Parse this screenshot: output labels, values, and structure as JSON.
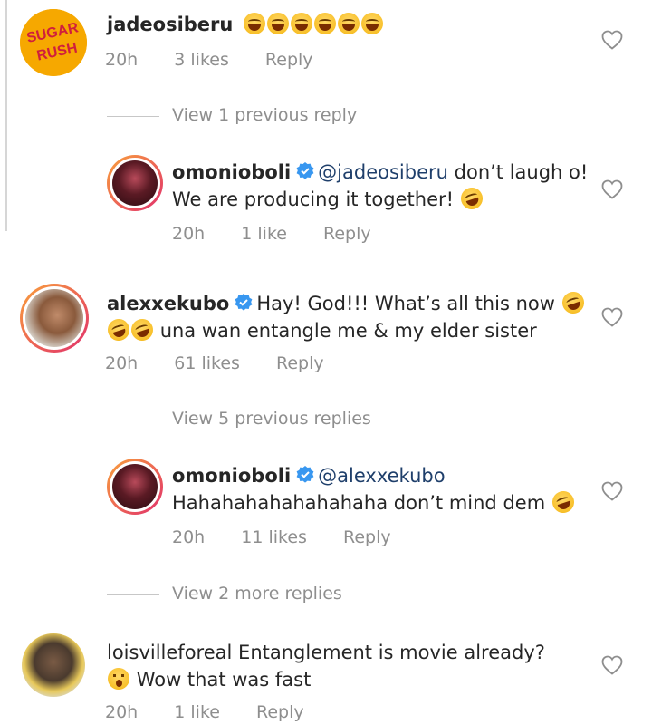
{
  "comments": [
    {
      "username": "jadeosiberu",
      "text": "",
      "emoji_count": 6,
      "time": "20h",
      "likes": "3 likes",
      "reply": "Reply",
      "avatar_text_1": "SUGAR",
      "avatar_text_2": "RUSH"
    },
    {
      "divider": "View 1 previous reply"
    },
    {
      "username": "omonioboli",
      "verified": true,
      "mention": "@jadeosiberu",
      "text_line1": "don’t laugh o!",
      "text_line2": "We are producing it together!",
      "time": "20h",
      "likes": "1 like",
      "reply": "Reply"
    },
    {
      "username": "alexxekubo",
      "verified": true,
      "text_line1": "Hay! God!!! What’s all this now",
      "text_line2": "una wan entangle me & my elder sister",
      "time": "20h",
      "likes": "61 likes",
      "reply": "Reply"
    },
    {
      "divider": "View 5 previous replies"
    },
    {
      "username": "omonioboli",
      "verified": true,
      "mention": "@alexxekubo",
      "text_line2": "Hahahahahahahahaha don’t mind dem",
      "time": "20h",
      "likes": "11 likes",
      "reply": "Reply"
    },
    {
      "divider": "View 2 more replies"
    },
    {
      "username": "loisvilleforeal",
      "text_line1": "Entanglement is movie already?",
      "text_line2": "Wow that was fast",
      "time": "20h",
      "likes": "1 like",
      "reply": "Reply"
    }
  ],
  "colors": {
    "meta_gray": "#8e8e8e",
    "mention_blue": "#1f3f6b",
    "verified_blue": "#3897f0"
  },
  "icons": {
    "like": "heart-outline-icon",
    "verified": "verified-badge-icon"
  }
}
